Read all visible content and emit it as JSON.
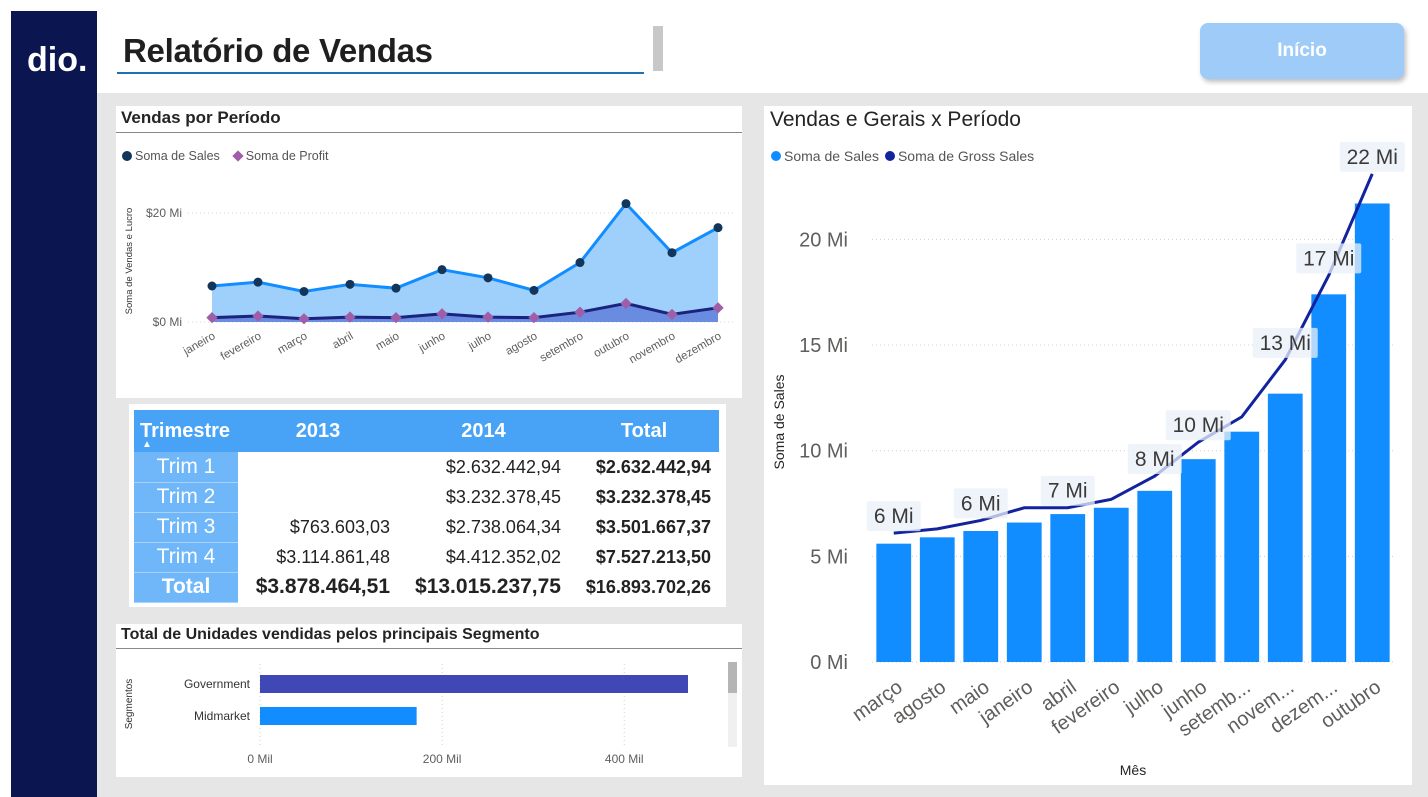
{
  "header": {
    "title": "Relatório de Vendas",
    "home_button": "Início",
    "brand_color": "#0b1651",
    "accent_color": "#118dff"
  },
  "period_chart": {
    "title": "Vendas por Período",
    "legend": [
      "Soma de  Sales",
      "Soma de Profit"
    ],
    "colors": {
      "sales": "#118dff",
      "sales_fill": "#9fd0fb",
      "sales_marker": "#12355b",
      "profit": "#1a237e",
      "profit_marker": "#a05ea8"
    }
  },
  "trend_chart": {
    "title": "Vendas e Gerais x Período",
    "legend": [
      "Soma de  Sales",
      "Soma de Gross Sales"
    ],
    "colors": {
      "bars": "#118dff",
      "line": "#12239e",
      "label_bg": "#e9f0fa"
    }
  },
  "quarter_table": {
    "header": [
      "Trimestre",
      "2013",
      "2014",
      "Total"
    ],
    "sort_icon": "triangle-up-icon",
    "rows": [
      {
        "label": "Trim 1",
        "y2013": "",
        "y2014": "$2.632.442,94",
        "total": "$2.632.442,94"
      },
      {
        "label": "Trim 2",
        "y2013": "",
        "y2014": "$3.232.378,45",
        "total": "$3.232.378,45"
      },
      {
        "label": "Trim 3",
        "y2013": "$763.603,03",
        "y2014": "$2.738.064,34",
        "total": "$3.501.667,37"
      },
      {
        "label": "Trim 4",
        "y2013": "$3.114.861,48",
        "y2014": "$4.412.352,02",
        "total": "$7.527.213,50"
      }
    ],
    "total": {
      "label": "Total",
      "y2013": "$3.878.464,51",
      "y2014": "$13.015.237,75",
      "total": "$16.893.702,26"
    }
  },
  "segment_chart": {
    "title": "Total de Unidades vendidas pelos principais Segmento",
    "colors": {
      "government": "#3f48b5",
      "midmarket": "#118dff"
    }
  },
  "chart_data": [
    {
      "type": "area",
      "title": "Vendas por Período",
      "xlabel": "",
      "ylabel": "Soma de Vendas e Lucro",
      "categories": [
        "janeiro",
        "fevereiro",
        "março",
        "abril",
        "maio",
        "junho",
        "julho",
        "agosto",
        "setembro",
        "outubro",
        "novembro",
        "dezembro"
      ],
      "series": [
        {
          "name": "Soma de  Sales",
          "values": [
            6.6,
            7.3,
            5.6,
            6.9,
            6.2,
            9.6,
            8.1,
            5.8,
            10.9,
            21.7,
            12.7,
            17.3
          ]
        },
        {
          "name": "Soma de Profit",
          "values": [
            0.8,
            1.1,
            0.6,
            0.9,
            0.8,
            1.5,
            0.9,
            0.8,
            1.8,
            3.4,
            1.4,
            2.6
          ]
        }
      ],
      "yticks": [
        "$0 Mi",
        "$20 Mi"
      ],
      "ytick_values": [
        0,
        20
      ],
      "ylim": [
        0,
        22
      ],
      "grid": true,
      "legend": "top-left"
    },
    {
      "type": "bar",
      "title": "Vendas e Gerais x Período",
      "xlabel": "Mês",
      "ylabel": "Soma de Sales",
      "categories": [
        "março",
        "agosto",
        "maio",
        "janeiro",
        "abril",
        "fevereiro",
        "julho",
        "junho",
        "setemb...",
        "novem...",
        "dezem...",
        "outubro"
      ],
      "series": [
        {
          "name": "Soma de  Sales",
          "values": [
            5.6,
            5.9,
            6.2,
            6.6,
            7.0,
            7.3,
            8.1,
            9.6,
            10.9,
            12.7,
            17.4,
            21.7
          ]
        },
        {
          "name": "Soma de Gross Sales",
          "values": [
            6.1,
            6.3,
            6.7,
            7.3,
            7.3,
            7.7,
            8.8,
            10.4,
            11.6,
            14.3,
            18.3,
            23.1
          ]
        }
      ],
      "data_labels": [
        {
          "index": 0,
          "text": "6 Mi"
        },
        {
          "index": 2,
          "text": "6 Mi"
        },
        {
          "index": 4,
          "text": "7 Mi"
        },
        {
          "index": 6,
          "text": "8 Mi"
        },
        {
          "index": 7,
          "text": "10 Mi"
        },
        {
          "index": 9,
          "text": "13 Mi"
        },
        {
          "index": 10,
          "text": "17 Mi"
        },
        {
          "index": 11,
          "text": "22 Mi"
        }
      ],
      "yticks": [
        "0 Mi",
        "5 Mi",
        "10 Mi",
        "15 Mi",
        "20 Mi"
      ],
      "ytick_values": [
        0,
        5,
        10,
        15,
        20
      ],
      "ylim": [
        0,
        23
      ],
      "grid": true,
      "legend": "top-left"
    },
    {
      "type": "bar",
      "title": "Total de Unidades vendidas pelos principais Segmento",
      "xlabel": "",
      "ylabel": "Segmentos",
      "categories": [
        "Government",
        "Midmarket"
      ],
      "values": [
        470,
        172
      ],
      "xticks": [
        "0 Mil",
        "200 Mil",
        "400 Mil"
      ],
      "xtick_values": [
        0,
        200,
        400
      ],
      "xlim": [
        0,
        470
      ]
    }
  ]
}
